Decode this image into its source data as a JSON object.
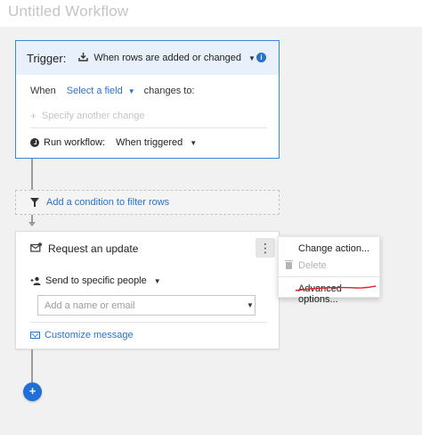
{
  "window": {
    "title": "Untitled Workflow"
  },
  "trigger": {
    "label": "Trigger:",
    "event": "When rows are added or changed",
    "when_label": "When",
    "field_select": "Select a field",
    "changes_to": "changes to:",
    "specify_another": "Specify another change",
    "run_label": "Run workflow:",
    "run_value": "When triggered"
  },
  "filter": {
    "label": "Add a condition to filter rows"
  },
  "action": {
    "title": "Request an update",
    "send_to": "Send to specific people",
    "recipient_placeholder": "Add a name or email",
    "customize": "Customize message"
  },
  "add_button": {
    "label": "+"
  },
  "menu": {
    "change_action": "Change action...",
    "delete": "Delete",
    "advanced": "Advanced options..."
  },
  "colors": {
    "accent": "#2a72c7",
    "trigger_header": "#e7f0fb",
    "add_button": "#1e6fd9",
    "annotation": "#d9262c"
  }
}
